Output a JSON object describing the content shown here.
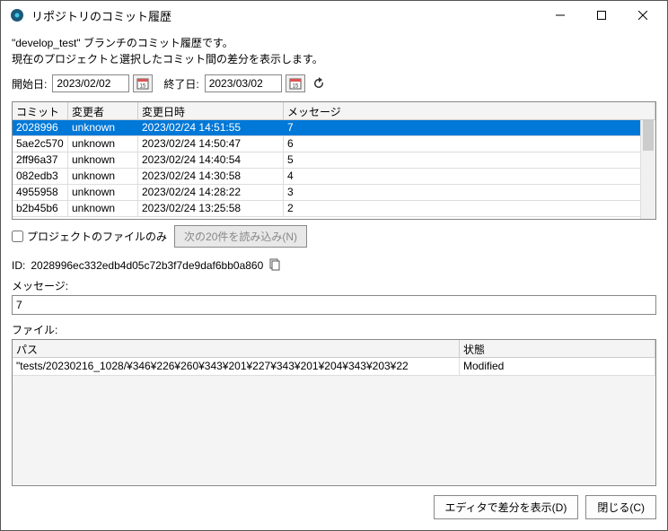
{
  "window": {
    "title": "リポジトリのコミット履歴"
  },
  "description": {
    "line1": "\"develop_test\" ブランチのコミット履歴です。",
    "line2": "現在のプロジェクトと選択したコミット間の差分を表示します。"
  },
  "dates": {
    "start_label": "開始日:",
    "start_value": "2023/02/02",
    "end_label": "終了日:",
    "end_value": "2023/03/02"
  },
  "commits": {
    "headers": {
      "commit": "コミット",
      "author": "変更者",
      "date": "変更日時",
      "message": "メッセージ"
    },
    "rows": [
      {
        "commit": "2028996",
        "author": "unknown",
        "date": "2023/02/24 14:51:55",
        "message": "7",
        "selected": true
      },
      {
        "commit": "5ae2c570",
        "author": "unknown",
        "date": "2023/02/24 14:50:47",
        "message": "6",
        "selected": false
      },
      {
        "commit": "2ff96a37",
        "author": "unknown",
        "date": "2023/02/24 14:40:54",
        "message": "5",
        "selected": false
      },
      {
        "commit": "082edb3",
        "author": "unknown",
        "date": "2023/02/24 14:30:58",
        "message": "4",
        "selected": false
      },
      {
        "commit": "4955958",
        "author": "unknown",
        "date": "2023/02/24 14:28:22",
        "message": "3",
        "selected": false
      },
      {
        "commit": "b2b45b6",
        "author": "unknown",
        "date": "2023/02/24 13:25:58",
        "message": "2",
        "selected": false
      }
    ]
  },
  "below": {
    "checkbox_label": "プロジェクトのファイルのみ",
    "load_button": "次の20件を読み込み(N)"
  },
  "detail": {
    "id_label": "ID:",
    "id_value": "2028996ec332edb4d05c72b3f7de9daf6bb0a860",
    "message_label": "メッセージ:",
    "message_value": "7",
    "files_label": "ファイル:",
    "file_headers": {
      "path": "パス",
      "status": "状態"
    },
    "file_rows": [
      {
        "path": "\"tests/20230216_1028/¥346¥226¥260¥343¥201¥227¥343¥201¥204¥343¥203¥22",
        "status": "Modified"
      }
    ]
  },
  "buttons": {
    "show_diff": "エディタで差分を表示(D)",
    "close": "閉じる(C)"
  }
}
